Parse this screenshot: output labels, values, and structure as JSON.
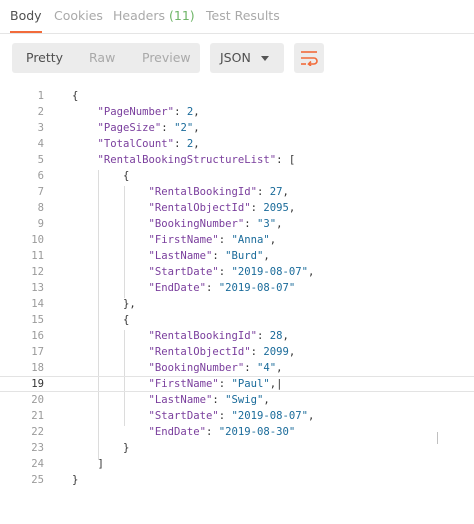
{
  "tabs": [
    {
      "label": "Body"
    },
    {
      "label": "Cookies"
    },
    {
      "label": "Headers",
      "count": "(11)"
    },
    {
      "label": "Test Results"
    }
  ],
  "view_modes": [
    "Pretty",
    "Raw",
    "Preview"
  ],
  "format_select": {
    "value": "JSON"
  },
  "accent_color": "#f26b3a",
  "code_lines": [
    {
      "n": "1",
      "html": "{"
    },
    {
      "n": "2",
      "html": "    <span class='k'>\"PageNumber\"</span>: <span class='n'>2</span>,"
    },
    {
      "n": "3",
      "html": "    <span class='k'>\"PageSize\"</span>: <span class='s'>\"2\"</span>,"
    },
    {
      "n": "4",
      "html": "    <span class='k'>\"TotalCount\"</span>: <span class='n'>2</span>,"
    },
    {
      "n": "5",
      "html": "    <span class='k'>\"RentalBookingStructureList\"</span>: ["
    },
    {
      "n": "6",
      "html": "        {"
    },
    {
      "n": "7",
      "html": "            <span class='k'>\"RentalBookingId\"</span>: <span class='n'>27</span>,"
    },
    {
      "n": "8",
      "html": "            <span class='k'>\"RentalObjectId\"</span>: <span class='n'>2095</span>,"
    },
    {
      "n": "9",
      "html": "            <span class='k'>\"BookingNumber\"</span>: <span class='s'>\"3\"</span>,"
    },
    {
      "n": "10",
      "html": "            <span class='k'>\"FirstName\"</span>: <span class='s'>\"Anna\"</span>,"
    },
    {
      "n": "11",
      "html": "            <span class='k'>\"LastName\"</span>: <span class='s'>\"Burd\"</span>,"
    },
    {
      "n": "12",
      "html": "            <span class='k'>\"StartDate\"</span>: <span class='s'>\"2019-08-07\"</span>,"
    },
    {
      "n": "13",
      "html": "            <span class='k'>\"EndDate\"</span>: <span class='s'>\"2019-08-07\"</span>"
    },
    {
      "n": "14",
      "html": "        },"
    },
    {
      "n": "15",
      "html": "        {"
    },
    {
      "n": "16",
      "html": "            <span class='k'>\"RentalBookingId\"</span>: <span class='n'>28</span>,"
    },
    {
      "n": "17",
      "html": "            <span class='k'>\"RentalObjectId\"</span>: <span class='n'>2099</span>,"
    },
    {
      "n": "18",
      "html": "            <span class='k'>\"BookingNumber\"</span>: <span class='s'>\"4\"</span>,"
    },
    {
      "n": "19",
      "html": "            <span class='k'>\"FirstName\"</span>: <span class='s'>\"Paul\"</span>,|",
      "current": true
    },
    {
      "n": "20",
      "html": "            <span class='k'>\"LastName\"</span>: <span class='s'>\"Swig\"</span>,"
    },
    {
      "n": "21",
      "html": "            <span class='k'>\"StartDate\"</span>: <span class='s'>\"2019-08-07\"</span>,"
    },
    {
      "n": "22",
      "html": "            <span class='k'>\"EndDate\"</span>: <span class='s'>\"2019-08-30\"</span>"
    },
    {
      "n": "23",
      "html": "        }"
    },
    {
      "n": "24",
      "html": "    ]"
    },
    {
      "n": "25",
      "html": "}"
    }
  ]
}
